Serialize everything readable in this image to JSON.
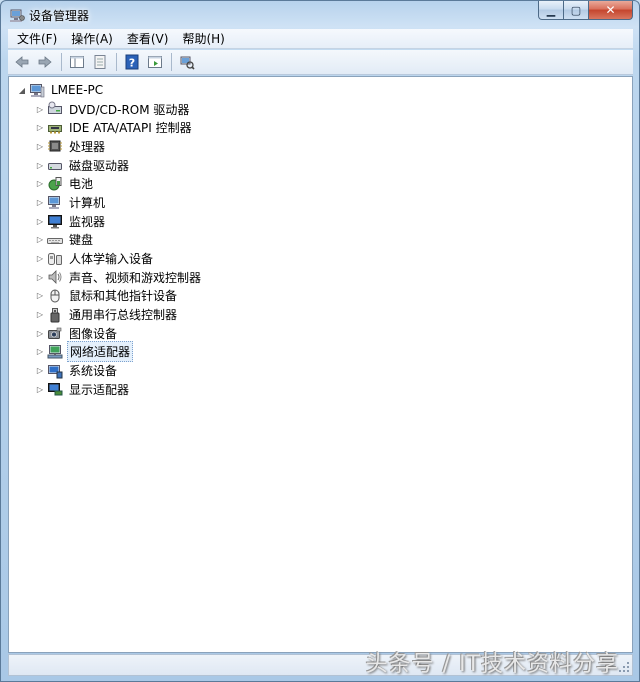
{
  "window": {
    "title": "设备管理器",
    "caption": {
      "minimize": "▁",
      "maximize": "▢",
      "close": "✕"
    }
  },
  "menu": [
    {
      "label": "文件(F)"
    },
    {
      "label": "操作(A)"
    },
    {
      "label": "查看(V)"
    },
    {
      "label": "帮助(H)"
    }
  ],
  "toolbar": {
    "buttons": [
      "back-arrow-icon",
      "forward-arrow-icon",
      "tree-view-icon",
      "properties-icon",
      "help-icon",
      "console-icon",
      "scan-hardware-icon"
    ]
  },
  "tree": {
    "root": {
      "label": "LMEE-PC",
      "icon": "computer-icon"
    },
    "children": [
      {
        "label": "DVD/CD-ROM 驱动器",
        "icon": "dvd-drive-icon"
      },
      {
        "label": "IDE ATA/ATAPI 控制器",
        "icon": "ide-controller-icon"
      },
      {
        "label": "处理器",
        "icon": "processor-icon"
      },
      {
        "label": "磁盘驱动器",
        "icon": "disk-drive-icon"
      },
      {
        "label": "电池",
        "icon": "battery-icon"
      },
      {
        "label": "计算机",
        "icon": "computer-icon"
      },
      {
        "label": "监视器",
        "icon": "monitor-icon"
      },
      {
        "label": "键盘",
        "icon": "keyboard-icon"
      },
      {
        "label": "人体学输入设备",
        "icon": "hid-icon"
      },
      {
        "label": "声音、视频和游戏控制器",
        "icon": "sound-icon"
      },
      {
        "label": "鼠标和其他指针设备",
        "icon": "mouse-icon"
      },
      {
        "label": "通用串行总线控制器",
        "icon": "usb-icon"
      },
      {
        "label": "图像设备",
        "icon": "camera-icon"
      },
      {
        "label": "网络适配器",
        "icon": "network-adapter-icon",
        "selected": true
      },
      {
        "label": "系统设备",
        "icon": "system-device-icon"
      },
      {
        "label": "显示适配器",
        "icon": "display-adapter-icon"
      }
    ]
  },
  "watermark": "头条号 / IT技术资料分享",
  "colors": {
    "accent": "#7da2ce",
    "window_frame": "#b7d2ec",
    "close_button": "#c4452d"
  }
}
